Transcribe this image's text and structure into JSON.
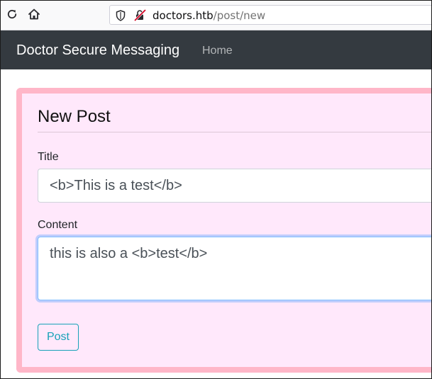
{
  "browser": {
    "url_host": "doctors.htb",
    "url_path": "/post/new",
    "icons": [
      "reload-icon",
      "home-icon",
      "shield-icon",
      "insecure-connection-icon"
    ]
  },
  "navbar": {
    "brand": "Doctor Secure Messaging",
    "links": [
      {
        "label": "Home"
      }
    ]
  },
  "form": {
    "legend": "New Post",
    "title_label": "Title",
    "title_value": "<b>This is a test</b>",
    "content_label": "Content",
    "content_value": "this is also a <b>test</b>",
    "submit_label": "Post"
  },
  "colors": {
    "navbar_bg": "#343a40",
    "card_bg": "#ffe8fb",
    "card_border": "#ffb6c8",
    "submit_accent": "#17a2b8",
    "focus_border": "#80bdff"
  }
}
